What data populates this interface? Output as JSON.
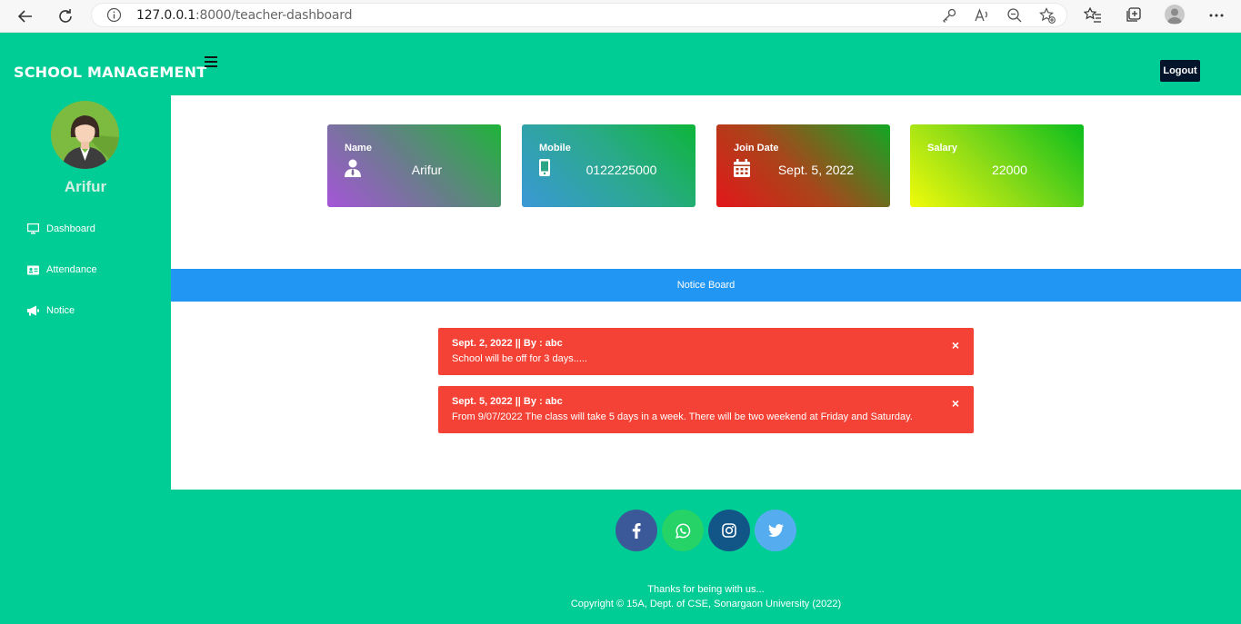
{
  "browser": {
    "url_host": "127.0.0.1",
    "url_rest": ":8000/teacher-dashboard"
  },
  "header": {
    "brand": "SCHOOL MANAGEMENT",
    "logout_label": "Logout"
  },
  "sidebar": {
    "profile_name": "Arifur",
    "items": [
      {
        "label": "Dashboard",
        "icon": "monitor-icon"
      },
      {
        "label": "Attendance",
        "icon": "id-card-icon"
      },
      {
        "label": "Notice",
        "icon": "megaphone-icon"
      }
    ]
  },
  "cards": [
    {
      "label": "Name",
      "value": "Arifur",
      "icon": "user-tie-icon"
    },
    {
      "label": "Mobile",
      "value": "0122225000",
      "icon": "mobile-icon"
    },
    {
      "label": "Join Date",
      "value": "Sept. 5, 2022",
      "icon": "calendar-icon"
    },
    {
      "label": "Salary",
      "value": "22000",
      "icon": ""
    }
  ],
  "notice_board": {
    "title": "Notice Board",
    "notices": [
      {
        "head": "Sept. 2, 2022 || By : abc",
        "body": "School will be off for 3 days.....",
        "close": "×"
      },
      {
        "head": "Sept. 5, 2022 || By : abc",
        "body": "From 9/07/2022 The class will take 5 days in a week. There will be two weekend at Friday and Saturday.",
        "close": "×"
      }
    ]
  },
  "footer": {
    "social": [
      "facebook-icon",
      "whatsapp-icon",
      "instagram-icon",
      "twitter-icon"
    ],
    "thanks": "Thanks for being with us...",
    "copyright": "Copyright © 15A, Dept. of CSE, Sonargaon University (2022)"
  },
  "colors": {
    "primary": "#00cc96",
    "notice_bar": "#2196f3",
    "notice_alert": "#f44336",
    "logout_bg": "#04142b"
  }
}
